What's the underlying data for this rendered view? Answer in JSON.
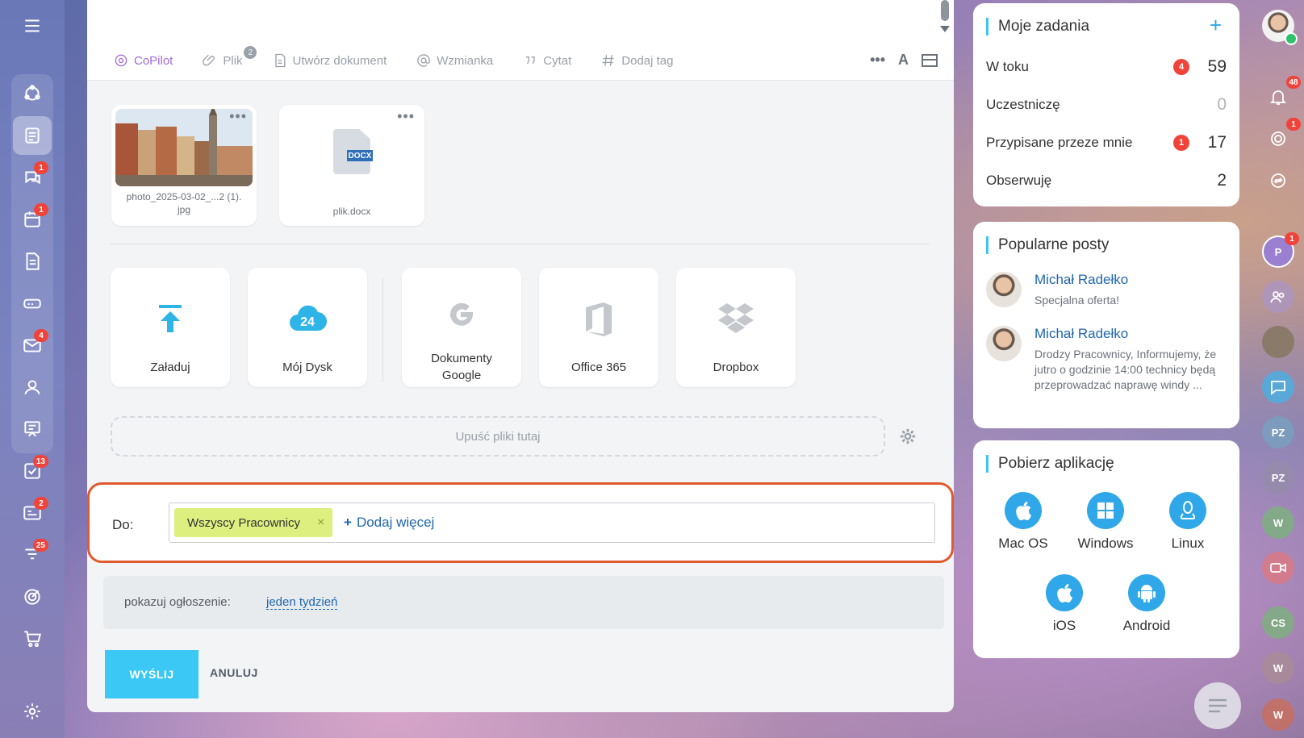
{
  "toolbar": {
    "copilot": "CoPilot",
    "file": "Plik",
    "file_count": "2",
    "create_doc": "Utwórz dokument",
    "mention": "Wzmianka",
    "quote": "Cytat",
    "add_tag": "Dodaj tag"
  },
  "files": [
    {
      "name": "photo_2025-03-02_...2 (1).",
      "ext": "jpg"
    },
    {
      "name": "plik",
      "ext": ".docx",
      "tag": "DOCX"
    }
  ],
  "sources": [
    {
      "label": "Załaduj",
      "icon": "upload-icon"
    },
    {
      "label": "Mój Dysk",
      "icon": "cloud-24-icon",
      "badge": "24"
    },
    {
      "label": "Dokumenty Google",
      "icon": "google-icon"
    },
    {
      "label": "Office 365",
      "icon": "office-icon"
    },
    {
      "label": "Dropbox",
      "icon": "dropbox-icon"
    }
  ],
  "dropzone": "Upuść pliki tutaj",
  "recipients": {
    "label": "Do:",
    "chip": "Wszyscy Pracownicy",
    "add_more": "Dodaj więcej"
  },
  "announcement": {
    "label": "pokazuj ogłoszenie:",
    "duration": "jeden tydzień"
  },
  "actions": {
    "send": "WYŚLIJ",
    "cancel": "ANULUJ"
  },
  "tasks_widget": {
    "title": "Moje zadania",
    "rows": [
      {
        "label": "W toku",
        "badge": "4",
        "count": "59"
      },
      {
        "label": "Uczestniczę",
        "count": "0"
      },
      {
        "label": "Przypisane przeze mnie",
        "badge": "1",
        "count": "17"
      },
      {
        "label": "Obserwuję",
        "count": "2"
      }
    ]
  },
  "posts_widget": {
    "title": "Popularne posty",
    "posts": [
      {
        "author": "Michał Radełko",
        "text": "Specjalna oferta!"
      },
      {
        "author": "Michał Radełko",
        "text": "Drodzy Pracownicy, Informujemy, że jutro o godzinie 14:00 technicy będą przeprowadzać naprawę windy ..."
      }
    ]
  },
  "apps_widget": {
    "title": "Pobierz aplikację",
    "apps": [
      "Mac OS",
      "Windows",
      "Linux",
      "iOS",
      "Android"
    ]
  },
  "left_rail_badges": {
    "chat": "1",
    "calendar": "1",
    "mail": "4",
    "tasks": "13",
    "news": "2",
    "feed": "25"
  },
  "right_rail": {
    "notifications_badge": "48",
    "target_badge": "1",
    "avatar_p": "P",
    "avatar_p_badge": "1",
    "initials": [
      "PZ",
      "PZ",
      "W",
      "CS",
      "W",
      "W"
    ]
  },
  "colors": {
    "accent": "#3bc8f5",
    "link": "#2067b0",
    "highlight_border": "#e15a2d",
    "chip": "#dcef7f",
    "badge": "#f0443a"
  }
}
